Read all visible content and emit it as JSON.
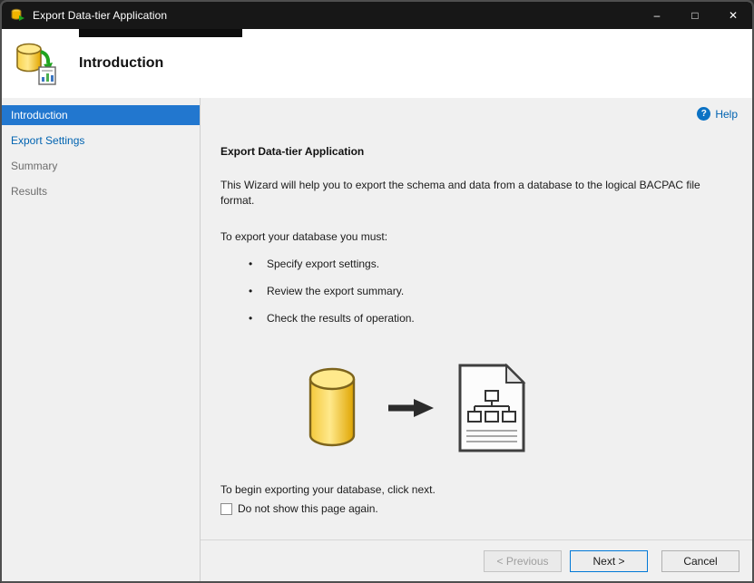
{
  "window": {
    "title": "Export Data-tier Application",
    "controls": {
      "minimize": "–",
      "maximize": "□",
      "close": "✕"
    }
  },
  "header": {
    "title": "Introduction"
  },
  "sidebar": {
    "items": [
      {
        "label": "Introduction",
        "state": "active"
      },
      {
        "label": "Export Settings",
        "state": "link"
      },
      {
        "label": "Summary",
        "state": "disabled"
      },
      {
        "label": "Results",
        "state": "disabled"
      }
    ]
  },
  "content": {
    "help_label": "Help",
    "help_glyph": "?",
    "heading": "Export Data-tier Application",
    "intro": "This Wizard will help you to export the schema and data from a database to the logical BACPAC file format.",
    "must_label": "To export your database you must:",
    "bullet_glyph": "•",
    "bullets": [
      "Specify export settings.",
      "Review the export summary.",
      "Check the results of operation."
    ],
    "begin_text": "To begin exporting your database, click next.",
    "checkbox_label": "Do not show this page again.",
    "checkbox_checked": false
  },
  "footer": {
    "previous_label": "< Previous",
    "next_label": "Next >",
    "cancel_label": "Cancel"
  },
  "icons": {
    "app": "database-export-icon",
    "header": "database-export-icon",
    "help": "help-question-icon",
    "illustration_left": "database-cylinder-icon",
    "illustration_mid": "right-arrow-icon",
    "illustration_right": "bacpac-document-icon"
  },
  "colors": {
    "accent": "#0078d7",
    "sidebar_active_bg": "#2277cf",
    "link": "#0063b1",
    "titlebar_bg": "#171717"
  }
}
